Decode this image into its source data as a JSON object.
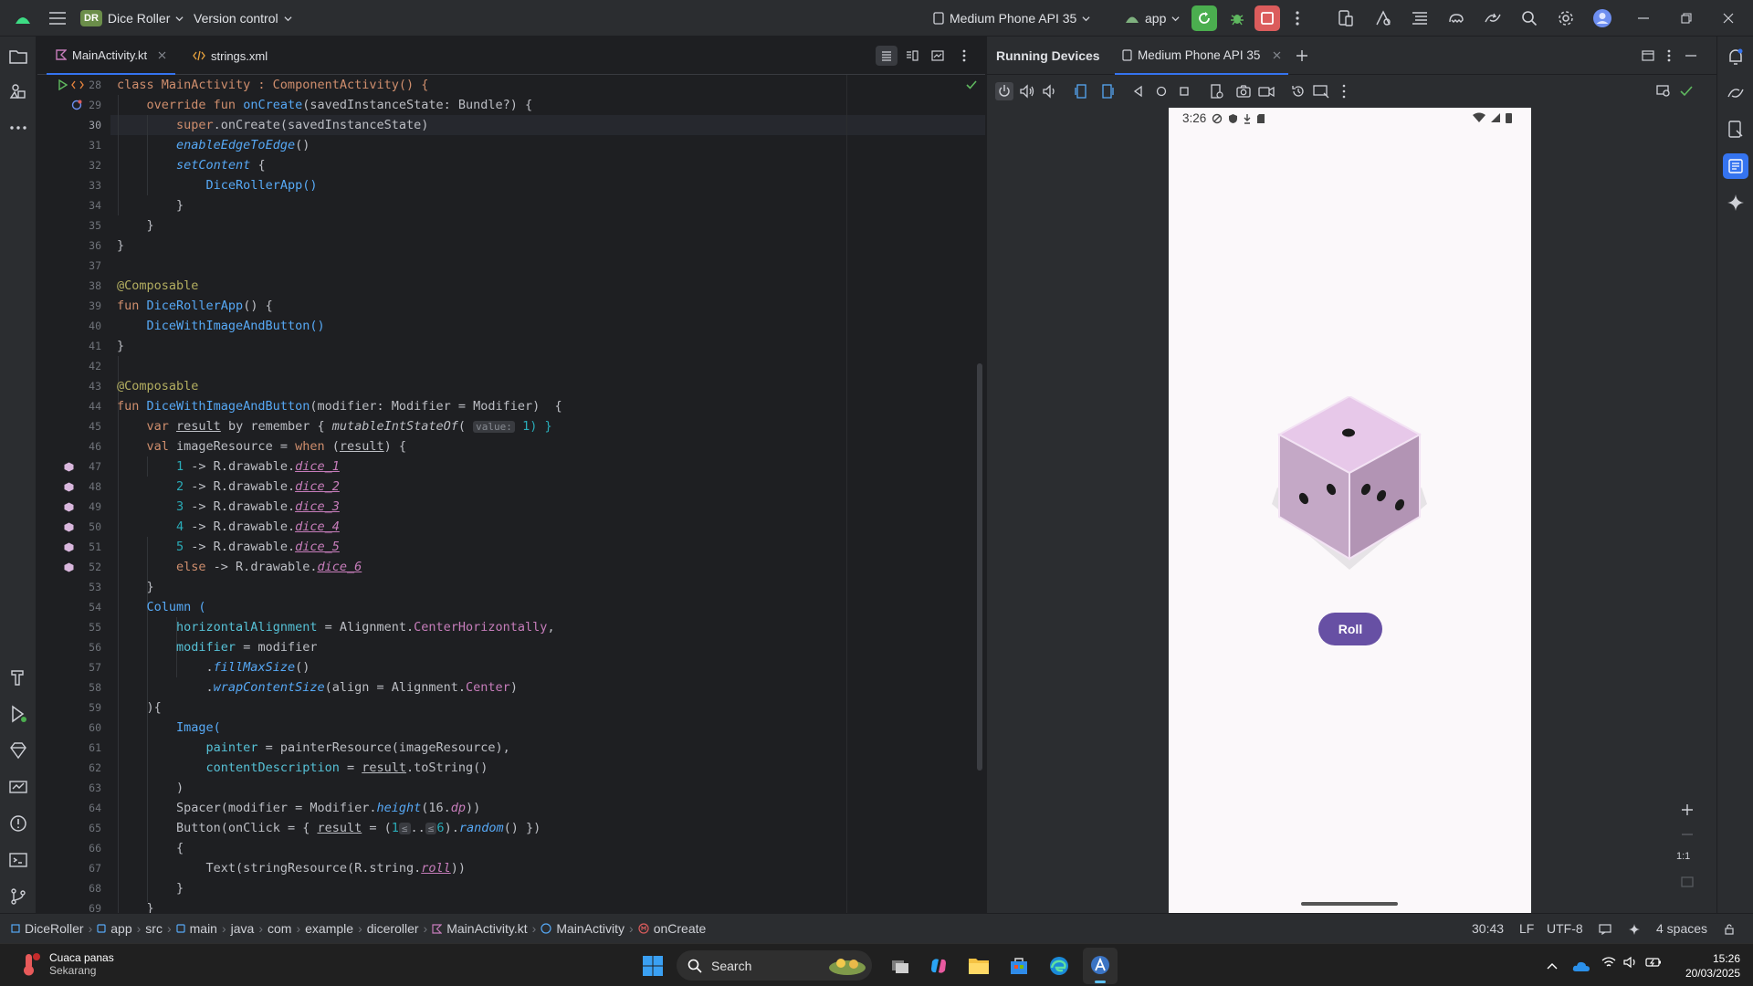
{
  "titlebar": {
    "project_badge": "DR",
    "project_name": "Dice Roller",
    "vcs": "Version control",
    "device": "Medium Phone API 35",
    "run_config": "app"
  },
  "editor": {
    "tabs": [
      {
        "label": "MainActivity.kt",
        "active": true
      },
      {
        "label": "strings.xml",
        "active": false
      }
    ],
    "line_numbers": [
      "28",
      "29",
      "30",
      "31",
      "32",
      "33",
      "34",
      "35",
      "36",
      "37",
      "38",
      "39",
      "40",
      "41",
      "42",
      "43",
      "44",
      "45",
      "46",
      "47",
      "48",
      "49",
      "50",
      "51",
      "52",
      "53",
      "54",
      "55",
      "56",
      "57",
      "58",
      "59",
      "60",
      "61",
      "62",
      "63",
      "64",
      "65",
      "66",
      "67",
      "68",
      "69"
    ],
    "current_line": "30",
    "inlay_hint_value": "value:",
    "inlay_hint_le": "≤",
    "code": {
      "l28": "class MainActivity : ComponentActivity() {",
      "l29a": "override fun ",
      "l29b": "onCreate",
      "l29c": "(savedInstanceState: Bundle?) {",
      "l30a": "super",
      "l30b": ".onCreate(savedInstanceState)",
      "l31": "enableEdgeToEdge",
      "l32": "setContent",
      "l33": "DiceRollerApp()",
      "l38": "@Composable",
      "l39a": "fun ",
      "l39b": "DiceRollerApp",
      "l39c": "() {",
      "l40": "DiceWithImageAndButton()",
      "l43": "@Composable",
      "l44a": "fun ",
      "l44b": "DiceWithImageAndButton",
      "l44c": "(modifier: Modifier = Modifier)  {",
      "l45a": "var ",
      "l45b": "result",
      "l45c": " by remember { ",
      "l45d": "mutableIntStateOf",
      "l45e": "1) }",
      "l46a": "val ",
      "l46b": "imageResource = ",
      "l46c": "when",
      "l46d": " (",
      "l46e": "result",
      "l46f": ") {",
      "dice": [
        {
          "n": "1",
          "res": "dice_1"
        },
        {
          "n": "2",
          "res": "dice_2"
        },
        {
          "n": "3",
          "res": "dice_3"
        },
        {
          "n": "4",
          "res": "dice_4"
        },
        {
          "n": "5",
          "res": "dice_5"
        }
      ],
      "drawable": " -> R.drawable.",
      "l52a": "else",
      "l52b": " -> R.drawable.",
      "l52c": "dice_6",
      "l54": "Column (",
      "l55a": "horizontalAlignment",
      "l55b": " = Alignment.",
      "l55c": "CenterHorizontally",
      "l56a": "modifier",
      "l56b": " = modifier",
      "l57": "fillMaxSize",
      "l58a": "wrapContentSize",
      "l58b": "(align = Alignment.",
      "l58c": "Center",
      "l60": "Image(",
      "l61a": "painter",
      "l61b": " = painterResource(imageResource),",
      "l62a": "contentDescription",
      "l62b": " = ",
      "l62c": "result",
      "l62d": ".toString()",
      "l64a": "Spacer(modifier = Modifier.",
      "l64b": "height",
      "l64c": "(16.",
      "l64d": "dp",
      "l64e": "))",
      "l65a": "Button(onClick = { ",
      "l65b": "result",
      "l65c": " = (",
      "l65d": "1",
      "l65e": "6",
      "l65f": ").",
      "l65g": "random",
      "l65h": "() })",
      "l67a": "Text(stringResource(R.string.",
      "l67b": "roll",
      "l67c": "))"
    }
  },
  "devices": {
    "title": "Running Devices",
    "tab": "Medium Phone API 35",
    "phone_time": "3:26",
    "roll_button": "Roll",
    "zoom_label": "1:1"
  },
  "status": {
    "breadcrumbs": [
      "DiceRoller",
      "app",
      "src",
      "main",
      "java",
      "com",
      "example",
      "diceroller",
      "MainActivity.kt",
      "MainActivity",
      "onCreate"
    ],
    "position": "30:43",
    "line_sep": "LF",
    "encoding": "UTF-8",
    "indent": "4 spaces"
  },
  "taskbar": {
    "weather_title": "Cuaca panas",
    "weather_sub": "Sekarang",
    "search": "Search",
    "time": "15:26",
    "date": "20/03/2025"
  },
  "colors": {
    "accent": "#3574f0",
    "roll_button": "#6750a4",
    "run_green": "#4bae4f",
    "stop_red": "#db5c5c"
  }
}
